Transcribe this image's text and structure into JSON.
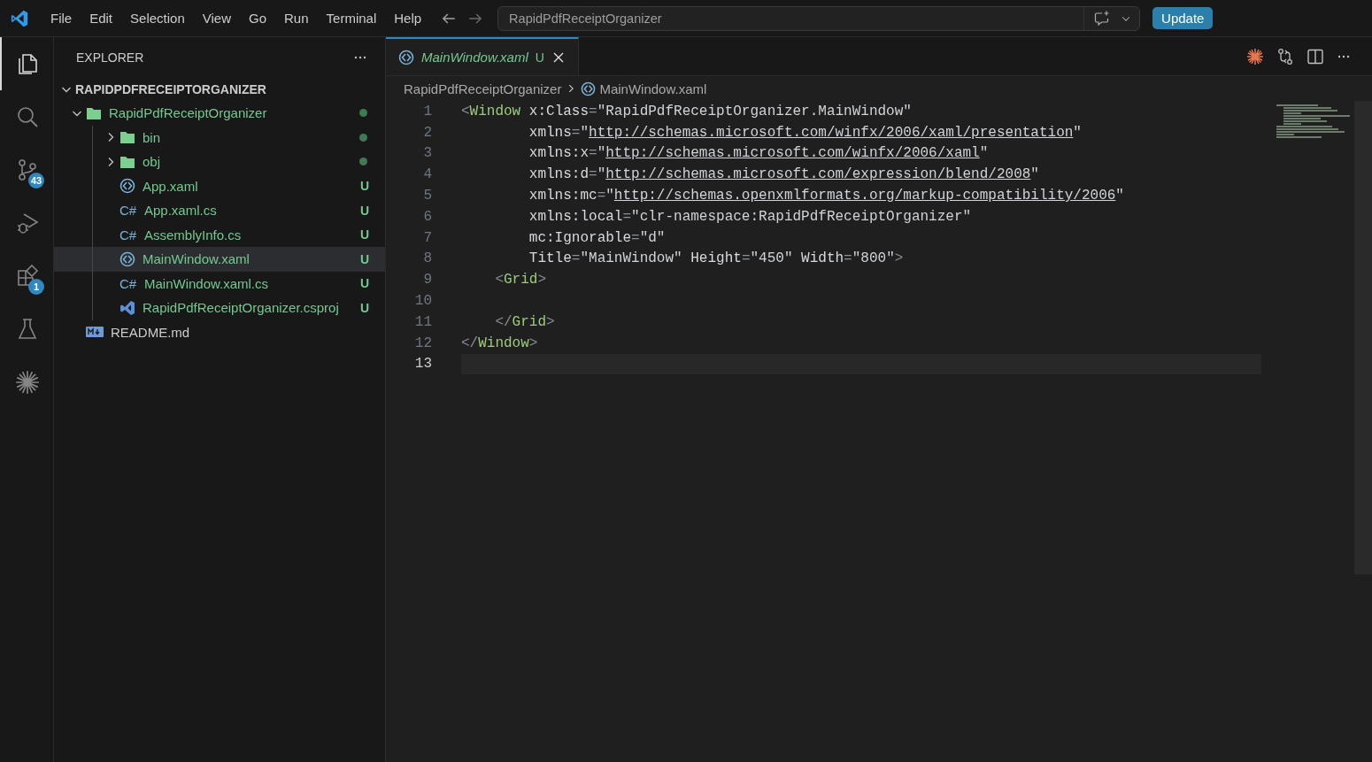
{
  "title_bar": {
    "menu": [
      "File",
      "Edit",
      "Selection",
      "View",
      "Go",
      "Run",
      "Terminal",
      "Help"
    ],
    "command_center": "RapidPdfReceiptOrganizer",
    "update_button": "Update"
  },
  "activity_bar": [
    {
      "kind": "files",
      "selected": true
    },
    {
      "kind": "search",
      "selected": false
    },
    {
      "kind": "source-control",
      "selected": false,
      "badge": "43"
    },
    {
      "kind": "debug",
      "selected": false
    },
    {
      "kind": "extensions",
      "selected": false,
      "badge": "1"
    },
    {
      "kind": "flask",
      "selected": false
    },
    {
      "kind": "sparkle",
      "selected": false
    }
  ],
  "explorer": {
    "title": "EXPLORER",
    "tree": [
      {
        "label": "RAPIDPDFRECEIPTORGANIZER",
        "kind": "root",
        "expanded": true,
        "untracked": false,
        "selected": false,
        "children": [
          {
            "label": "RapidPdfReceiptOrganizer",
            "kind": "folder",
            "expanded": true,
            "untracked": true,
            "selected": false,
            "dot": true,
            "children": [
              {
                "label": "bin",
                "kind": "folder",
                "expanded": false,
                "untracked": true,
                "selected": false,
                "dot": true
              },
              {
                "label": "obj",
                "kind": "folder",
                "expanded": false,
                "untracked": true,
                "selected": false,
                "dot": true
              },
              {
                "label": "App.xaml",
                "kind": "xaml",
                "untracked": true,
                "selected": false,
                "status": "U"
              },
              {
                "label": "App.xaml.cs",
                "kind": "csharp",
                "icon": "C#",
                "untracked": true,
                "selected": false,
                "status": "U"
              },
              {
                "label": "AssemblyInfo.cs",
                "kind": "csharp",
                "icon": "C#",
                "untracked": true,
                "selected": false,
                "status": "U"
              },
              {
                "label": "MainWindow.xaml",
                "kind": "xaml",
                "untracked": true,
                "selected": true,
                "status": "U"
              },
              {
                "label": "MainWindow.xaml.cs",
                "kind": "csharp",
                "icon": "C#",
                "untracked": true,
                "selected": false,
                "status": "U"
              },
              {
                "label": "RapidPdfReceiptOrganizer.csproj",
                "kind": "csproj",
                "untracked": true,
                "selected": false,
                "status": "U"
              }
            ]
          },
          {
            "label": "README.md",
            "kind": "markdown",
            "untracked": false,
            "selected": false
          }
        ]
      }
    ]
  },
  "editor": {
    "tab": {
      "label": "MainWindow.xaml",
      "status": "U",
      "preview": true,
      "selected": true
    },
    "breadcrumb": [
      "RapidPdfReceiptOrganizer",
      "MainWindow.xaml"
    ],
    "lines": [
      {
        "number": "1",
        "current": false,
        "tokens": [
          {
            "kind": "punct",
            "text": "<"
          },
          {
            "kind": "tag",
            "text": "Window"
          },
          {
            "kind": "attr",
            "text": " x:Class"
          },
          {
            "kind": "punct",
            "text": "="
          },
          {
            "kind": "string",
            "text": "\"RapidPdfReceiptOrganizer.MainWindow\""
          }
        ]
      },
      {
        "number": "2",
        "current": false,
        "tokens": [
          {
            "kind": "attr",
            "text": "        xmlns"
          },
          {
            "kind": "punct",
            "text": "="
          },
          {
            "kind": "string",
            "text": "\""
          },
          {
            "kind": "link",
            "text": "http://schemas.microsoft.com/winfx/2006/xaml/presentation"
          },
          {
            "kind": "string",
            "text": "\""
          }
        ]
      },
      {
        "number": "3",
        "current": false,
        "tokens": [
          {
            "kind": "attr",
            "text": "        xmlns:x"
          },
          {
            "kind": "punct",
            "text": "="
          },
          {
            "kind": "string",
            "text": "\""
          },
          {
            "kind": "link",
            "text": "http://schemas.microsoft.com/winfx/2006/xaml"
          },
          {
            "kind": "string",
            "text": "\""
          }
        ]
      },
      {
        "number": "4",
        "current": false,
        "tokens": [
          {
            "kind": "attr",
            "text": "        xmlns:d"
          },
          {
            "kind": "punct",
            "text": "="
          },
          {
            "kind": "string",
            "text": "\""
          },
          {
            "kind": "link",
            "text": "http://schemas.microsoft.com/expression/blend/2008"
          },
          {
            "kind": "string",
            "text": "\""
          }
        ]
      },
      {
        "number": "5",
        "current": false,
        "tokens": [
          {
            "kind": "attr",
            "text": "        xmlns:mc"
          },
          {
            "kind": "punct",
            "text": "="
          },
          {
            "kind": "string",
            "text": "\""
          },
          {
            "kind": "link",
            "text": "http://schemas.openxmlformats.org/markup-compatibility/2006"
          },
          {
            "kind": "string",
            "text": "\""
          }
        ]
      },
      {
        "number": "6",
        "current": false,
        "tokens": [
          {
            "kind": "attr",
            "text": "        xmlns:local"
          },
          {
            "kind": "punct",
            "text": "="
          },
          {
            "kind": "string",
            "text": "\"clr-namespace:RapidPdfReceiptOrganizer\""
          }
        ]
      },
      {
        "number": "7",
        "current": false,
        "tokens": [
          {
            "kind": "attr",
            "text": "        mc:Ignorable"
          },
          {
            "kind": "punct",
            "text": "="
          },
          {
            "kind": "string",
            "text": "\"d\""
          }
        ]
      },
      {
        "number": "8",
        "current": false,
        "tokens": [
          {
            "kind": "attr",
            "text": "        Title"
          },
          {
            "kind": "punct",
            "text": "="
          },
          {
            "kind": "string",
            "text": "\"MainWindow\""
          },
          {
            "kind": "attr",
            "text": " Height"
          },
          {
            "kind": "punct",
            "text": "="
          },
          {
            "kind": "string",
            "text": "\"450\""
          },
          {
            "kind": "attr",
            "text": " Width"
          },
          {
            "kind": "punct",
            "text": "="
          },
          {
            "kind": "string",
            "text": "\"800\""
          },
          {
            "kind": "punct",
            "text": ">"
          }
        ]
      },
      {
        "number": "9",
        "current": false,
        "tokens": [
          {
            "kind": "punct",
            "text": "    <"
          },
          {
            "kind": "tag",
            "text": "Grid"
          },
          {
            "kind": "punct",
            "text": ">"
          }
        ]
      },
      {
        "number": "10",
        "current": false
      },
      {
        "number": "11",
        "current": false,
        "tokens": [
          {
            "kind": "punct",
            "text": "    </"
          },
          {
            "kind": "tag",
            "text": "Grid"
          },
          {
            "kind": "punct",
            "text": ">"
          }
        ]
      },
      {
        "number": "12",
        "current": false,
        "tokens": [
          {
            "kind": "punct",
            "text": "</"
          },
          {
            "kind": "tag",
            "text": "Window"
          },
          {
            "kind": "punct",
            "text": ">"
          }
        ]
      },
      {
        "number": "13",
        "current": true
      }
    ]
  }
}
